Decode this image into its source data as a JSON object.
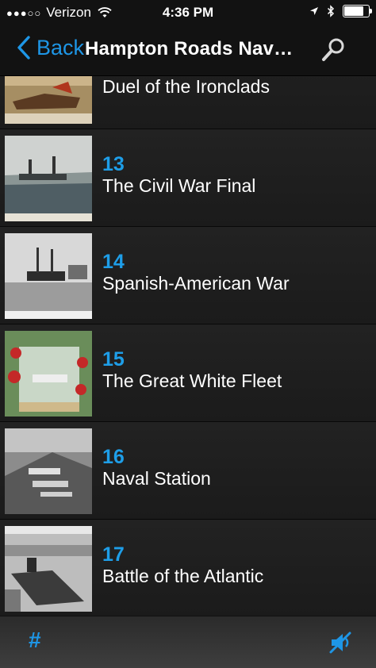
{
  "status_bar": {
    "signal": "●●●○○",
    "carrier": "Verizon",
    "time": "4:36 PM",
    "battery_level": 0.85
  },
  "nav_bar": {
    "back_label": "Back",
    "title": "Hampton Roads Nav…",
    "search_icon": "search-icon"
  },
  "list": {
    "partial_item": {
      "title": "Duel of the Ironclads"
    },
    "items": [
      {
        "number": "13",
        "title": "The Civil War Final"
      },
      {
        "number": "14",
        "title": "Spanish-American War"
      },
      {
        "number": "15",
        "title": "The Great White Fleet"
      },
      {
        "number": "16",
        "title": "Naval Station"
      },
      {
        "number": "17",
        "title": "Battle of the Atlantic"
      }
    ]
  },
  "tab_bar": {
    "hash_label": "#",
    "mute_icon": "speaker-muted-icon"
  },
  "colors": {
    "accent": "#1e96e6",
    "background": "#1c1c1c",
    "bar": "#121212"
  }
}
